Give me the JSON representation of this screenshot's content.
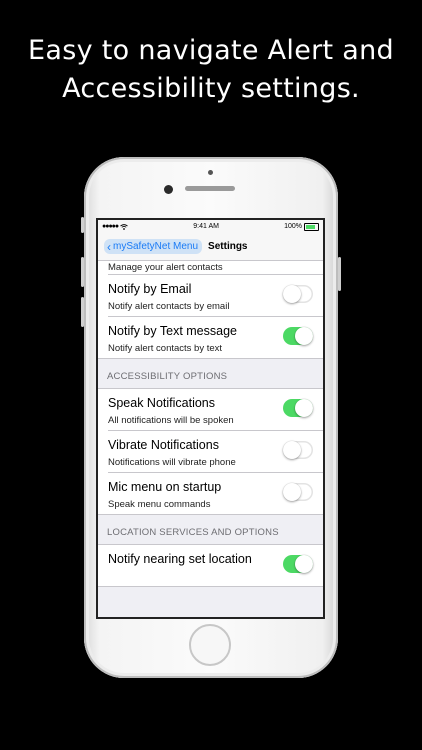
{
  "headline": {
    "line1": "Easy to navigate Alert and",
    "line2": "Accessibility settings."
  },
  "status_bar": {
    "signal": "●●●●●",
    "wifi_icon": "wifi-icon",
    "time": "9:41 AM",
    "battery_pct": "100%",
    "battery_icon": "battery-icon"
  },
  "nav": {
    "back_label": "mySafetyNet Menu",
    "title": "Settings"
  },
  "alerts": {
    "contacts_sub": "Manage your alert contacts",
    "email_title": "Notify by Email",
    "email_sub": "Notify alert contacts by email",
    "email_on": false,
    "text_title": "Notify by Text message",
    "text_sub": "Notify alert contacts by text",
    "text_on": true
  },
  "accessibility": {
    "header": "ACCESSIBILITY OPTIONS",
    "speak_title": "Speak Notifications",
    "speak_sub": "All notifications will be spoken",
    "speak_on": true,
    "vibrate_title": "Vibrate Notifications",
    "vibrate_sub": "Notifications will vibrate phone",
    "vibrate_on": false,
    "mic_title": "Mic menu on startup",
    "mic_sub": "Speak menu commands",
    "mic_on": false
  },
  "location": {
    "header": "LOCATION SERVICES AND OPTIONS",
    "nearing_title": "Notify nearing set location",
    "nearing_on": true
  },
  "colors": {
    "toggle_on": "#4cd964",
    "tint": "#1a7bf5",
    "background": "#000000"
  }
}
